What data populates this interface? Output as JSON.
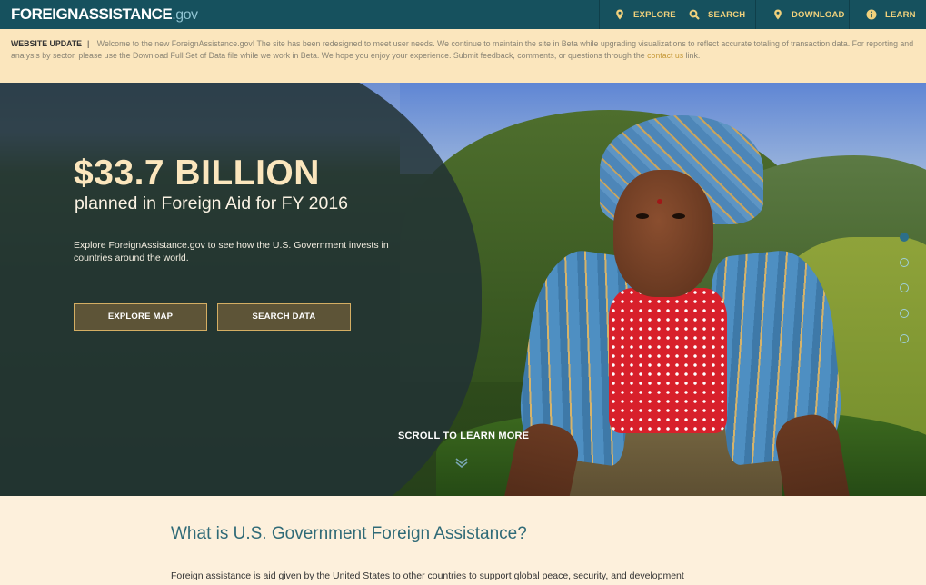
{
  "header": {
    "logo_main": "FOREIGNASSISTANCE",
    "logo_suffix": ".gov",
    "nav": [
      {
        "label": "EXPLORE",
        "icon": "map-marker-icon"
      },
      {
        "label": "SEARCH",
        "icon": "search-icon"
      },
      {
        "label": "DOWNLOAD",
        "icon": "map-marker-icon"
      },
      {
        "label": "LEARN",
        "icon": "info-icon"
      }
    ]
  },
  "update_banner": {
    "label": "WEBSITE UPDATE",
    "separator": "|",
    "text": "Welcome to the new ForeignAssistance.gov! The site has been redesigned to meet user needs. We continue to maintain the site in Beta while upgrading visualizations to reflect accurate totaling of transaction data. For reporting and analysis by sector, please use the Download Full Set of Data file while we work in Beta. We hope you enjoy your experience. Submit feedback, comments, or questions through the",
    "link_text": "contact us",
    "tail": "link."
  },
  "hero": {
    "headline": "$33.7 BILLION",
    "subline": "planned in Foreign Aid for FY 2016",
    "description": "Explore ForeignAssistance.gov to see how the U.S. Government invests in countries around the world.",
    "button_map": "EXPLORE MAP",
    "button_search": "SEARCH DATA",
    "scroll_text": "SCROLL TO LEARN MORE",
    "slide_count": 5,
    "active_slide": 1
  },
  "section": {
    "title": "What is U.S. Government Foreign Assistance?",
    "text": "Foreign assistance is aid given by the United States to other countries to support global peace, security, and development"
  },
  "colors": {
    "header_bg": "#16515e",
    "nav_text": "#f1d17c",
    "banner_bg": "#fbe6bd",
    "accent_gold": "#d4ae63",
    "section_title": "#2f6a77"
  }
}
